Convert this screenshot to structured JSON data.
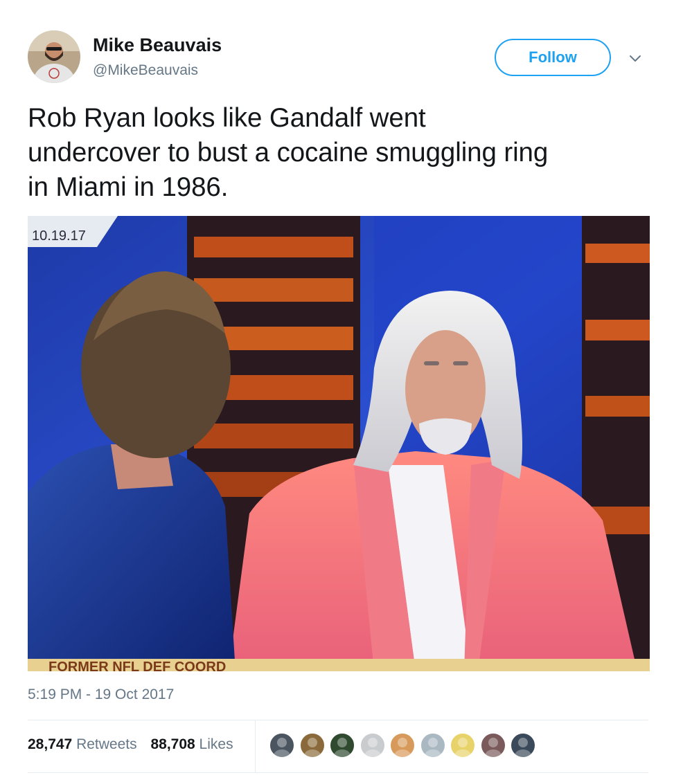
{
  "author": {
    "name": "Mike Beauvais",
    "handle": "@MikeBeauvais",
    "avatar_icon": "profile-photo"
  },
  "actions": {
    "follow_label": "Follow",
    "more_icon": "chevron-down-icon"
  },
  "tweet": {
    "text_lines": [
      "Rob Ryan looks like Gandalf went",
      "undercover to bust a cocaine smuggling ring",
      "in Miami in 1986."
    ],
    "timestamp": "5:19 PM - 19 Oct 2017"
  },
  "media": {
    "overlay_date": "10.19.17",
    "lower_third_text": "FORMER NFL DEF COORD"
  },
  "stats": {
    "retweets_count": "28,747",
    "retweets_label": "Retweets",
    "likes_count": "88,708",
    "likes_label": "Likes"
  },
  "likers": [
    {
      "name": "liker-avatar-1",
      "color": "#4a5560"
    },
    {
      "name": "liker-avatar-2",
      "color": "#8a6a3a"
    },
    {
      "name": "liker-avatar-3",
      "color": "#2f4a2f"
    },
    {
      "name": "liker-avatar-4",
      "color": "#c9cccf"
    },
    {
      "name": "liker-avatar-5",
      "color": "#d89a5a"
    },
    {
      "name": "liker-avatar-6",
      "color": "#aab8c2"
    },
    {
      "name": "liker-avatar-7",
      "color": "#e8d36a"
    },
    {
      "name": "liker-avatar-8",
      "color": "#7a5a5a"
    },
    {
      "name": "liker-avatar-9",
      "color": "#3a4a5a"
    }
  ],
  "colors": {
    "accent": "#1da1f2",
    "secondary_text": "#657786",
    "primary_text": "#14171a"
  }
}
